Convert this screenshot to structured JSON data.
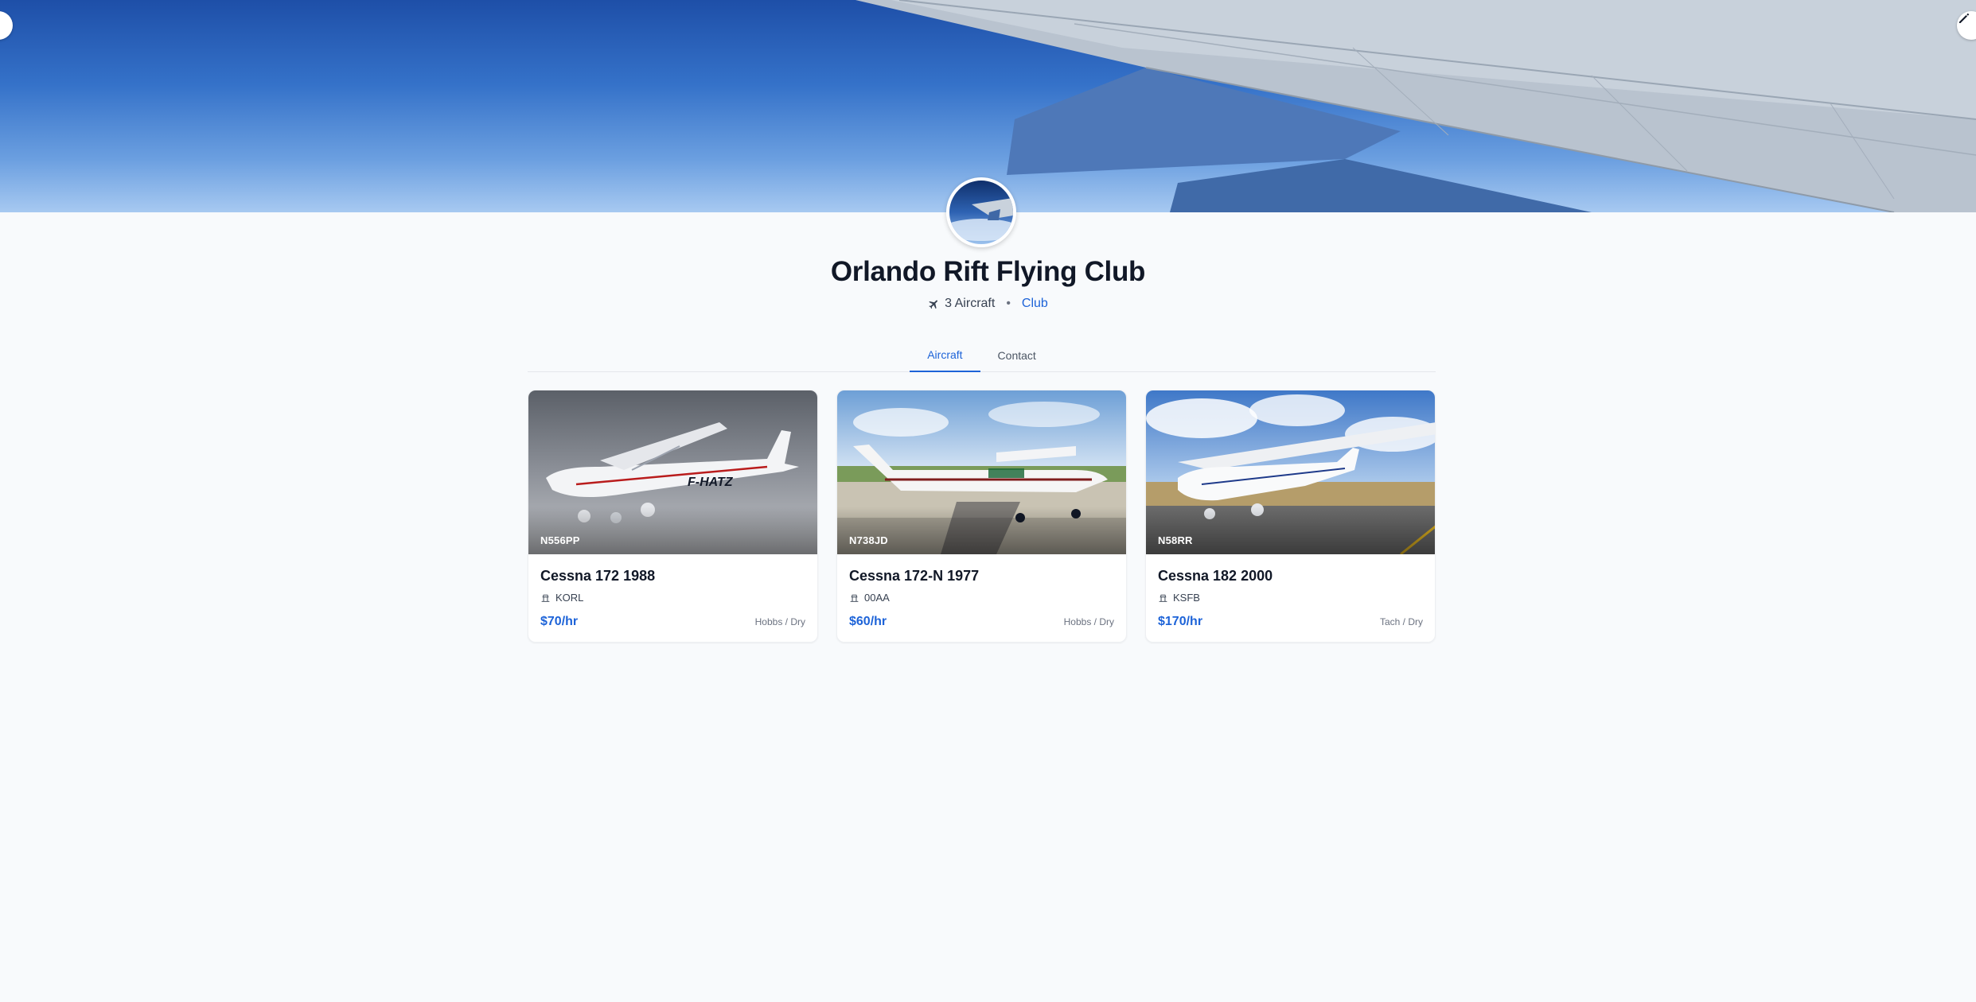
{
  "club": {
    "name": "Orlando Rift Flying Club",
    "aircraft_count": "3 Aircraft",
    "type": "Club"
  },
  "tabs": [
    {
      "label": "Aircraft",
      "active": true
    },
    {
      "label": "Contact",
      "active": false
    }
  ],
  "icons": {
    "banner_left": "edge-circle-icon",
    "banner_right": "edit-pencil-icon",
    "meta": "airplane-icon",
    "airport": "airport-tower-icon"
  },
  "colors": {
    "accent": "#1d63d8",
    "background": "#f8fafc"
  },
  "aircraft": [
    {
      "tail": "N556PP",
      "title": "Cessna 172 1988",
      "airport": "KORL",
      "rate": "$70/hr",
      "billing": "Hobbs / Dry"
    },
    {
      "tail": "N738JD",
      "title": "Cessna 172-N 1977",
      "airport": "00AA",
      "rate": "$60/hr",
      "billing": "Hobbs / Dry"
    },
    {
      "tail": "N58RR",
      "title": "Cessna 182 2000",
      "airport": "KSFB",
      "rate": "$170/hr",
      "billing": "Tach / Dry"
    }
  ]
}
